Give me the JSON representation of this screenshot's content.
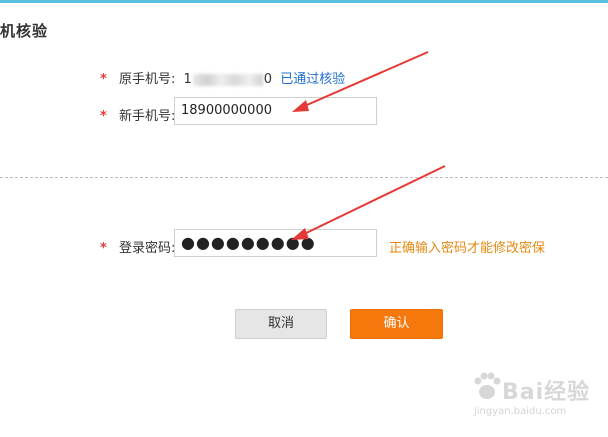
{
  "section_title": "机核验",
  "original_phone": {
    "label": "原手机号:",
    "prefix": "1",
    "suffix": "0",
    "verified_text": "已通过核验"
  },
  "new_phone": {
    "label": "新手机号:",
    "value": "18900000000"
  },
  "password": {
    "label": "登录密码:",
    "value": "●●●●●●●●●",
    "hint": "正确输入密码才能修改密保"
  },
  "buttons": {
    "cancel": "取消",
    "confirm": "确认"
  },
  "required_mark": "*",
  "watermark": {
    "brand": "Bai经验",
    "url": "jingyan.baidu.com"
  },
  "colors": {
    "accent_border": "#5bc0de",
    "required": "#e4393c",
    "link": "#1f6fd0",
    "hint": "#e58a11",
    "confirm_button": "#f5780c",
    "arrow": "#e53935"
  }
}
